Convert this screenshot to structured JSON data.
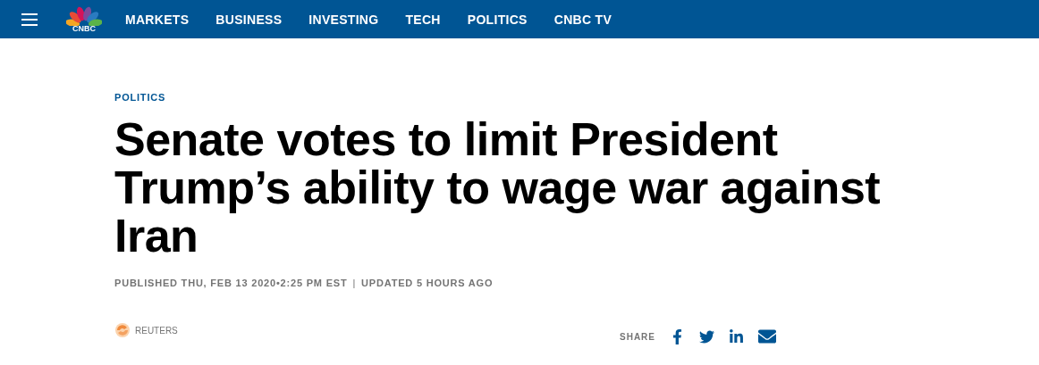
{
  "nav": {
    "logo_text": "CNBC",
    "items": [
      {
        "label": "MARKETS"
      },
      {
        "label": "BUSINESS"
      },
      {
        "label": "INVESTING"
      },
      {
        "label": "TECH"
      },
      {
        "label": "POLITICS"
      },
      {
        "label": "CNBC TV"
      }
    ]
  },
  "article": {
    "kicker": "POLITICS",
    "headline": "Senate votes to limit President Trump’s ability to wage war against Iran",
    "published": "PUBLISHED THU, FEB 13 2020•2:25 PM EST",
    "separator": "|",
    "updated": "UPDATED 5 HOURS AGO",
    "source": "REUTERS",
    "share_label": "SHARE"
  }
}
